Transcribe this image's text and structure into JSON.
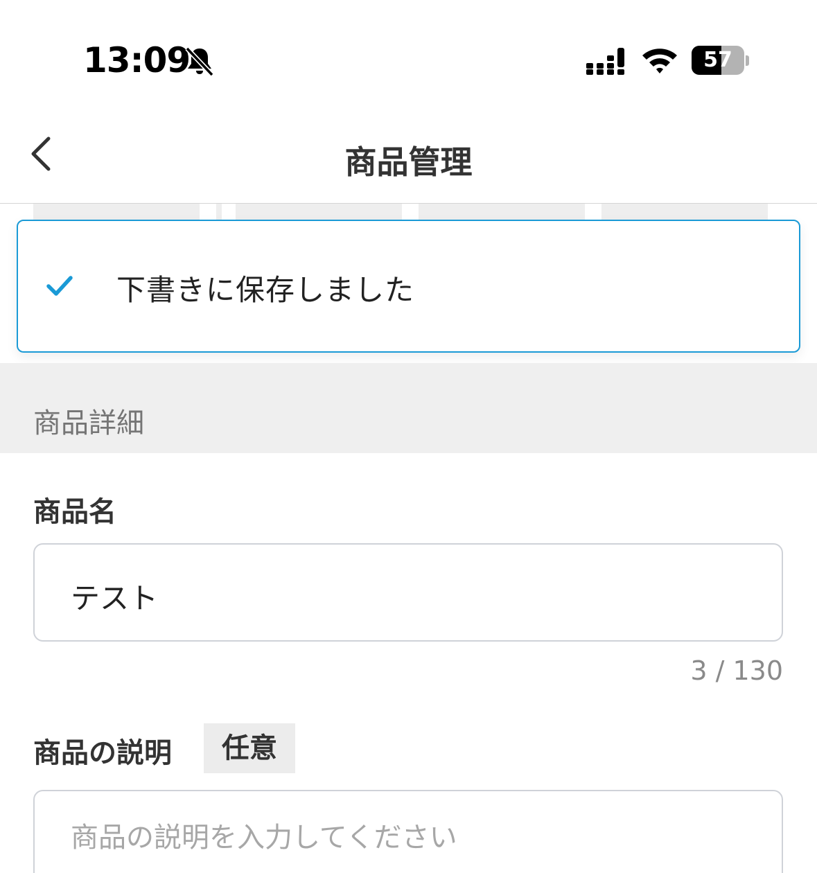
{
  "status_bar": {
    "time": "13:09",
    "battery_level": "57",
    "icons": [
      "bell-slash-icon",
      "cellular-signal-icon",
      "wifi-icon",
      "battery-icon"
    ]
  },
  "nav": {
    "title": "商品管理",
    "back_icon": "chevron-left-icon"
  },
  "toast": {
    "message": "下書きに保存しました",
    "icon": "check-icon",
    "border_color": "#1a9ad6",
    "icon_color": "#1a9ad6"
  },
  "section": {
    "title": "商品詳細"
  },
  "form": {
    "name_label": "商品名",
    "name_value": "テスト",
    "name_counter": "3 / 130",
    "description_label": "商品の説明",
    "optional_badge": "任意",
    "description_placeholder": "商品の説明を入力してください"
  }
}
